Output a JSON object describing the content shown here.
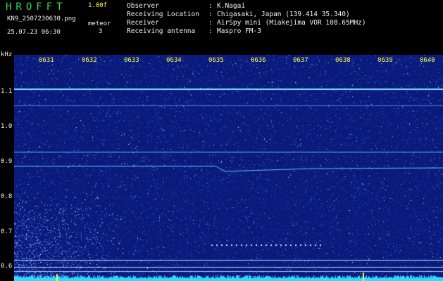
{
  "header": {
    "logo": "HROFFT",
    "version": "1.00f",
    "filename": "KN9_2507230630.png",
    "datetime": "25.07.23 06:30",
    "meteor_label": "meteor",
    "meteor_count": "3"
  },
  "info": [
    {
      "label": "Observer",
      "value": "K.Nagai"
    },
    {
      "label": "Receiving Location",
      "value": "Chigasaki, Japan (139.414 35.340)"
    },
    {
      "label": "Receiver",
      "value": "AirSpy mini (Miakejima VOR 108.65MHz)"
    },
    {
      "label": "Receiving antenna",
      "value": "Maspro FM-3"
    }
  ],
  "axis": {
    "unit": "kHz",
    "y_ticks": [
      "1.1",
      "1.0",
      "0.9",
      "0.8",
      "0.7",
      "0.6"
    ],
    "time_ticks": [
      "0631",
      "0632",
      "0633",
      "0634",
      "0635",
      "0636",
      "0637",
      "0638",
      "0639",
      "0640"
    ]
  },
  "colors": {
    "background": "#000000",
    "spectrogram": "#0a1a7a",
    "label_green": "#39d84a",
    "time_yellow": "#ffff3a",
    "baseline_cyan": "#36d8ff"
  }
}
